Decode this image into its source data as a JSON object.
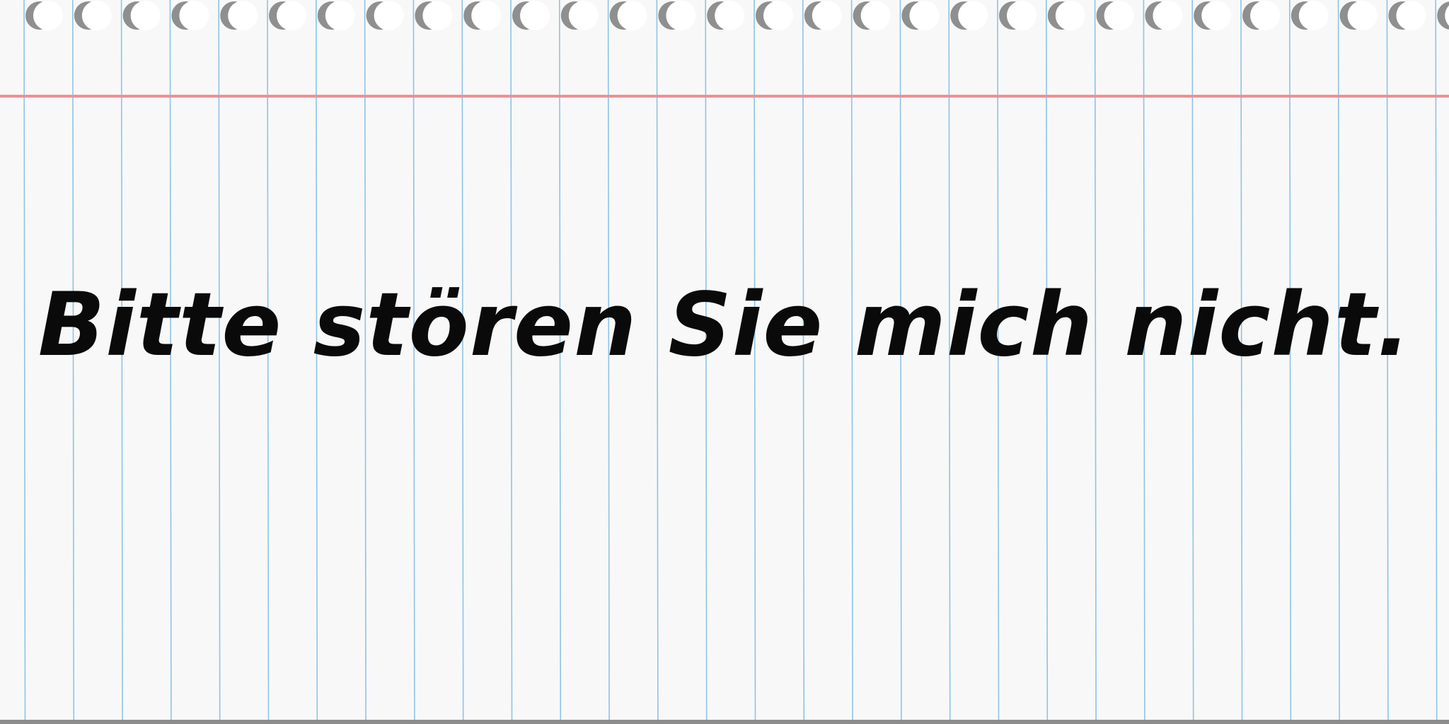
{
  "note": {
    "text": "Bitte stören Sie mich nicht."
  },
  "colors": {
    "paper": "#f8f8f8",
    "rule_line": "#8ec3e6",
    "margin_line": "#ef8f94",
    "binding_hole_shadow": "#8f8f8f",
    "binding_hole": "#ffffff",
    "bottom_edge": "#8c8c8c"
  }
}
